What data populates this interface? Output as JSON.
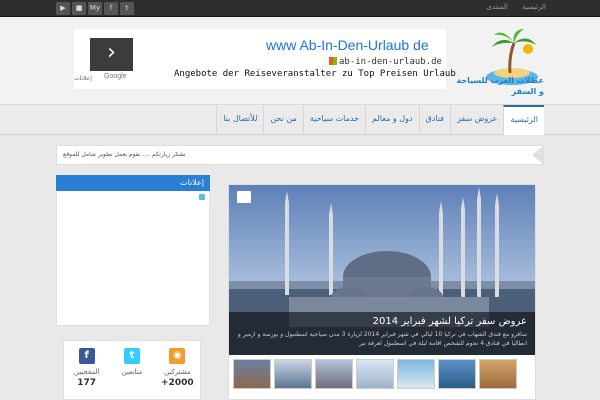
{
  "topbar": {
    "social_icons": [
      {
        "name": "youtube-icon",
        "glyph": "▶"
      },
      {
        "name": "delicious-icon",
        "glyph": "■"
      },
      {
        "name": "myspace-icon",
        "glyph": "My"
      },
      {
        "name": "facebook-icon",
        "glyph": "f"
      },
      {
        "name": "twitter-icon",
        "glyph": "t"
      }
    ],
    "nav": [
      "الرئيسية",
      "المنتدى"
    ]
  },
  "header": {
    "logo_text": "عطلات العرب للسياحة و السفر",
    "ad": {
      "title": "www Ab-In-Den-Urlaub de",
      "url": "ab-in-den-urlaub.de",
      "description": "Angebote der Reiseveranstalter zu Top Preisen Urlaub",
      "google_label": "Google",
      "ads_label": "إعلانات",
      "arrow": "›"
    }
  },
  "main_nav": {
    "items": [
      "الرئيسية",
      "عروض سفر",
      "فنادق",
      "دول و معالم",
      "خدمات سياحية",
      "من نحن",
      "للأتصال بنا"
    ]
  },
  "ticker": {
    "text": "تشكر زيارتكم .... نقوم بعمل تطوير شامل للموقع"
  },
  "sidebar": {
    "ads_heading": "إعلانات",
    "counters": [
      {
        "icon": "facebook-icon",
        "glyph": "f",
        "color": "#3b5998",
        "label": "المعجبين",
        "count": "177"
      },
      {
        "icon": "twitter-icon",
        "glyph": "t",
        "color": "#33ccff",
        "label": "متابعين",
        "count": ""
      },
      {
        "icon": "rss-icon",
        "glyph": "◉",
        "color": "#f59b2a",
        "label": "مشتركين",
        "count": "+2000"
      }
    ]
  },
  "slider": {
    "title": "عروض سفر تركيا لشهر فبراير 2014",
    "excerpt": "سافرو مع فندق الشهاب في تركيا 10 ليالي في شهر فبراير 2014 لزيارة 3 مدن سياحية اسطنبول و بورصة و ازمير و انطاليا في فنادق 4 نجوم للشخص اقامة ليلة في اسطنبول لعرفة نير"
  },
  "colors": {
    "accent": "#2a7fd4",
    "topbar": "#2e2e2e",
    "nav_link": "#2a6ea6"
  }
}
